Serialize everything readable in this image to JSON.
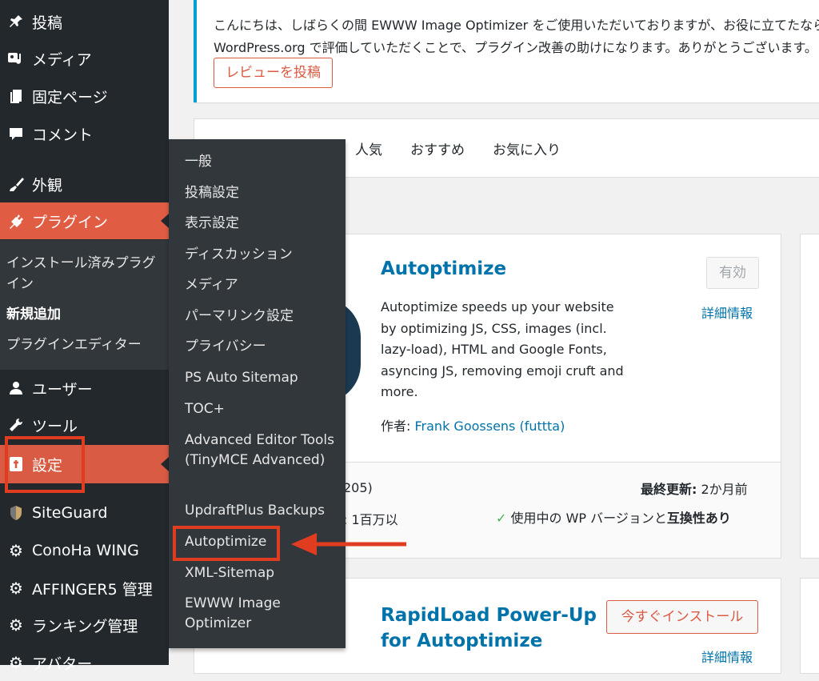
{
  "sidebar": {
    "items": [
      {
        "label": "投稿",
        "icon": "pin-icon"
      },
      {
        "label": "メディア",
        "icon": "media-icon"
      },
      {
        "label": "固定ページ",
        "icon": "pages-icon"
      },
      {
        "label": "コメント",
        "icon": "comment-icon"
      },
      {
        "label": "外観",
        "icon": "brush-icon"
      },
      {
        "label": "プラグイン",
        "icon": "plugin-icon"
      },
      {
        "label": "ユーザー",
        "icon": "user-icon"
      },
      {
        "label": "ツール",
        "icon": "wrench-icon"
      },
      {
        "label": "設定",
        "icon": "settings-icon"
      },
      {
        "label": "SiteGuard",
        "icon": "shield-icon"
      },
      {
        "label": "ConoHa WING",
        "icon": "gear-icon"
      },
      {
        "label": "AFFINGER5 管理",
        "icon": "gear-icon"
      },
      {
        "label": "ランキング管理",
        "icon": "gear-icon"
      },
      {
        "label": "アバター",
        "icon": "gear-icon"
      }
    ],
    "plugin_submenu": [
      "インストール済みプラグイン",
      "新規追加",
      "プラグインエディター"
    ]
  },
  "flyout": {
    "items": [
      "一般",
      "投稿設定",
      "表示設定",
      "ディスカッション",
      "メディア",
      "パーマリンク設定",
      "プライバシー",
      "PS Auto Sitemap",
      "TOC+",
      "Advanced Editor Tools (TinyMCE Advanced)",
      "UpdraftPlus Backups",
      "Autoptimize",
      "XML-Sitemap",
      "EWWW Image Optimizer"
    ]
  },
  "notice": {
    "line1": "こんにちは、しばらくの間 EWWW Image Optimizer をご使用いただいておりますが、お役に立てたなら",
    "line2": "WordPress.org で評価していただくことで、プラグイン改善の助けになります。ありがとうございます。",
    "button": "レビューを投稿"
  },
  "tabs": [
    "人気",
    "おすすめ",
    "お気に入り"
  ],
  "card1": {
    "title": "Autoptimize",
    "description": "Autoptimize speeds up your website by optimizing JS, CSS, images (incl. lazy-load), HTML and Google Fonts, asyncing JS, removing emoji cruft and more.",
    "author_label": "作者:",
    "author_name": "Frank Goossens (futtta)",
    "status_button": "有効",
    "details_link": "詳細情報",
    "ratings_partial": "205)",
    "installs_partial": ": 1百万以",
    "last_updated_label": "最終更新:",
    "last_updated_value": "2か月前",
    "compat_check": "✓",
    "compat_text": "使用中の WP バージョンと",
    "compat_strong": "互換性あり"
  },
  "card2": {
    "title_line1": "RapidLoad Power-Up",
    "title_line2": "for Autoptimize",
    "install_button": "今すぐインストール",
    "details_link": "詳細情報"
  },
  "colors": {
    "sidebar_bg": "#23282d",
    "active_bg": "#e05d44",
    "link": "#0073aa",
    "highlight": "#e03c1f"
  }
}
